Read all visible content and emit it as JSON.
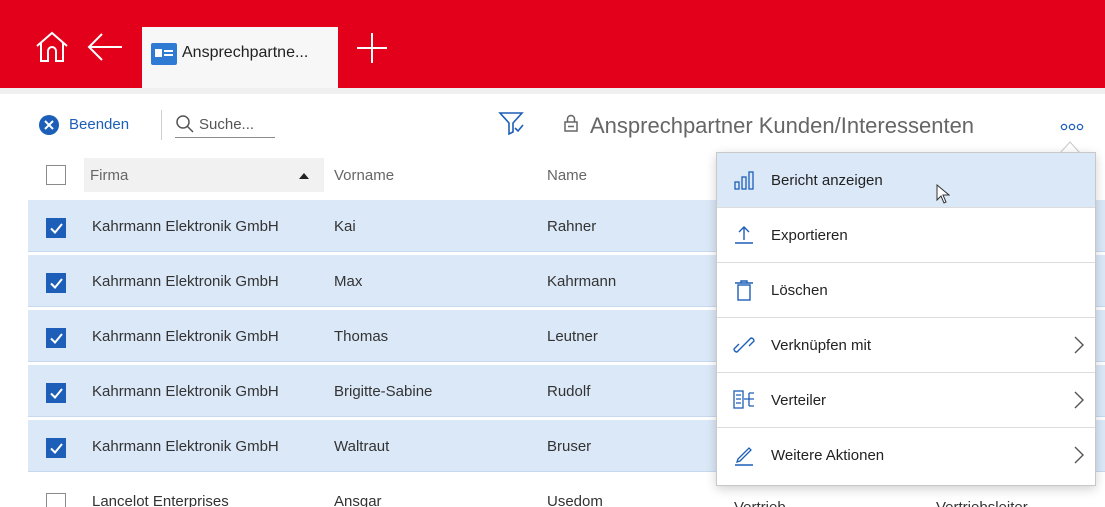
{
  "app": {
    "tab_label": "Ansprechpartne...",
    "view_title": "Ansprechpartner Kunden/Interessenten",
    "colors": {
      "brand_red": "#e2001a",
      "accent_blue": "#1d5fb8",
      "selected_row": "#dbe8f8"
    }
  },
  "toolbar": {
    "close_label": "Beenden",
    "search_placeholder": "Suche...",
    "more_label": "ooo"
  },
  "table": {
    "columns": [
      "Firma",
      "Vorname",
      "Name"
    ],
    "sort": {
      "column": "Firma",
      "direction": "ascending"
    },
    "rows": [
      {
        "checked": true,
        "firma": "Kahrmann Elektronik GmbH",
        "vorname": "Kai",
        "name": "Rahner"
      },
      {
        "checked": true,
        "firma": "Kahrmann Elektronik GmbH",
        "vorname": "Max",
        "name": "Kahrmann"
      },
      {
        "checked": true,
        "firma": "Kahrmann Elektronik GmbH",
        "vorname": "Thomas",
        "name": "Leutner"
      },
      {
        "checked": true,
        "firma": "Kahrmann Elektronik GmbH",
        "vorname": "Brigitte-Sabine",
        "name": "Rudolf"
      },
      {
        "checked": true,
        "firma": "Kahrmann Elektronik GmbH",
        "vorname": "Waltraut",
        "name": "Bruser"
      },
      {
        "checked": false,
        "firma": "Lancelot Enterprises",
        "vorname": "Ansgar",
        "name": "Usedom",
        "extra1": "Vertrieb",
        "extra2": "Vertriebsleiter"
      }
    ]
  },
  "menu": {
    "items": [
      {
        "label": "Bericht anzeigen",
        "icon": "bar-chart-icon",
        "submenu": false,
        "hovered": true
      },
      {
        "label": "Exportieren",
        "icon": "export-icon",
        "submenu": false
      },
      {
        "label": "Löschen",
        "icon": "trash-icon",
        "submenu": false
      },
      {
        "label": "Verknüpfen mit",
        "icon": "link-icon",
        "submenu": true
      },
      {
        "label": "Verteiler",
        "icon": "distribution-icon",
        "submenu": true
      },
      {
        "label": "Weitere Aktionen",
        "icon": "pen-icon",
        "submenu": true
      }
    ]
  }
}
